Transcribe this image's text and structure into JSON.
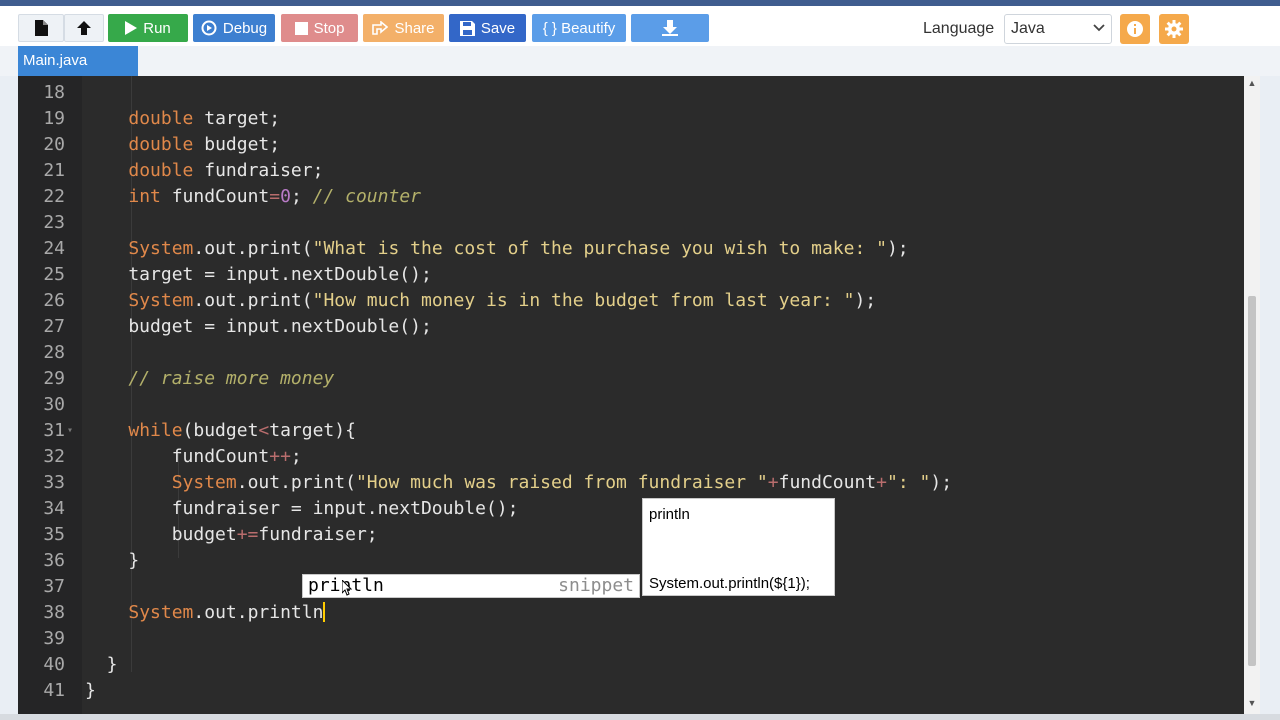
{
  "toolbar": {
    "run": "Run",
    "debug": "Debug",
    "stop": "Stop",
    "share": "Share",
    "save": "Save",
    "beautify": "{ } Beautify",
    "language_label": "Language",
    "language_value": "Java"
  },
  "tabs": [
    {
      "label": "Main.java",
      "active": true
    }
  ],
  "editor": {
    "line_numbers": [
      "18",
      "19",
      "20",
      "21",
      "22",
      "23",
      "24",
      "25",
      "26",
      "27",
      "28",
      "29",
      "30",
      "31",
      "32",
      "33",
      "34",
      "35",
      "36",
      "37",
      "38",
      "39",
      "40",
      "41"
    ],
    "lines": [
      {
        "text": ""
      },
      {
        "text": "double target;"
      },
      {
        "text": "double budget;"
      },
      {
        "text": "double fundraiser;"
      },
      {
        "text": "int fundCount=0; // counter"
      },
      {
        "text": ""
      },
      {
        "text": "System.out.print(\"What is the cost of the purchase you wish to make: \");"
      },
      {
        "text": "target = input.nextDouble();"
      },
      {
        "text": "System.out.print(\"How much money is in the budget from last year: \");"
      },
      {
        "text": "budget = input.nextDouble();"
      },
      {
        "text": ""
      },
      {
        "text": "// raise more money"
      },
      {
        "text": ""
      },
      {
        "text": "while(budget<target){"
      },
      {
        "text": "fundCount++;"
      },
      {
        "text": "System.out.print(\"How much was raised from fundraiser \"+fundCount+\": \");"
      },
      {
        "text": "fundraiser = input.nextDouble();"
      },
      {
        "text": "budget+=fundraiser;"
      },
      {
        "text": "}"
      },
      {
        "text": ""
      },
      {
        "text": "System.out.println"
      },
      {
        "text": ""
      },
      {
        "text": "}"
      },
      {
        "text": "}"
      }
    ]
  },
  "autocomplete": {
    "item": "println",
    "type": "snippet",
    "doc_title": "println",
    "doc_signature": "System.out.println(${1});"
  },
  "colors": {
    "run": "#36a94a",
    "debug": "#3d7fd0",
    "stop": "#df8c8c",
    "share": "#f3b069",
    "save": "#3367c8",
    "beautify": "#5b9de8",
    "editor_bg": "#2b2b2b",
    "keyword": "#e0884a",
    "string": "#e3cf8a"
  },
  "icons": [
    "new-file-icon",
    "upload-icon",
    "play-icon",
    "debug-icon",
    "stop-icon",
    "share-icon",
    "save-icon",
    "download-icon",
    "info-icon",
    "gear-icon",
    "fold-arrow-icon",
    "mouse-cursor-icon"
  ]
}
